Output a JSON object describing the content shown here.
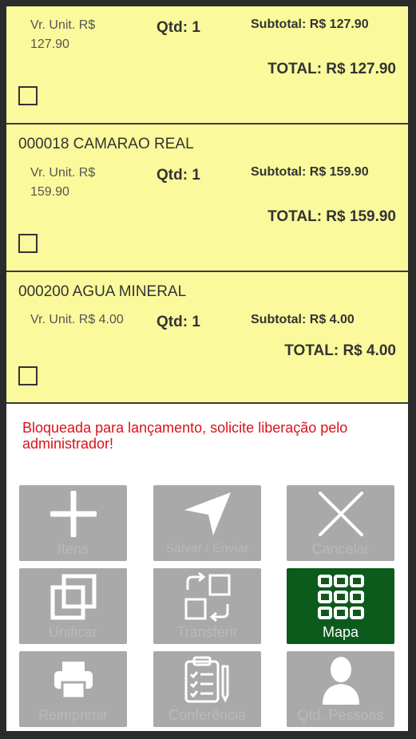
{
  "items": [
    {
      "name": "",
      "unit_label": "Vr. Unit. R$",
      "unit_value": "127.90",
      "qtd": "Qtd: 1",
      "subtotal": "Subtotal: R$ 127.90",
      "total": "TOTAL: R$ 127.90"
    },
    {
      "name": "000018 CAMARAO REAL",
      "unit_label": "Vr. Unit. R$",
      "unit_value": "159.90",
      "qtd": "Qtd: 1",
      "subtotal": "Subtotal: R$ 159.90",
      "total": "TOTAL: R$ 159.90"
    },
    {
      "name": "000200 AGUA MINERAL",
      "unit_label": "Vr. Unit. R$ 4.00",
      "unit_value": "",
      "qtd": "Qtd: 1",
      "subtotal": "Subtotal: R$ 4.00",
      "total": "TOTAL: R$ 4.00"
    }
  ],
  "message": "Bloqueada para lançamento, solicite liberação pelo administrador!",
  "buttons": {
    "itens": "Itens",
    "salvar": "Salvar / Enviar",
    "cancelar": "Cancelar",
    "unificar": "Unificar",
    "transferir": "Transferir",
    "mapa": "Mapa",
    "reimprimir": "Reimprimir",
    "conferencia": "Conferência",
    "qtd_pessoas": "Qtd. Pessoas"
  },
  "colors": {
    "item_bg": "#fafa9c",
    "button_disabled": "#a9a9a9",
    "button_active": "#0d5b1c",
    "error_text": "#d9121b"
  },
  "icons": {
    "itens": "plus-icon",
    "salvar": "send-arrow-icon",
    "cancelar": "close-icon",
    "unificar": "merge-squares-icon",
    "transferir": "transfer-icon",
    "mapa": "grid-map-icon",
    "reimprimir": "printer-icon",
    "conferencia": "clipboard-checklist-icon",
    "qtd_pessoas": "person-icon"
  }
}
